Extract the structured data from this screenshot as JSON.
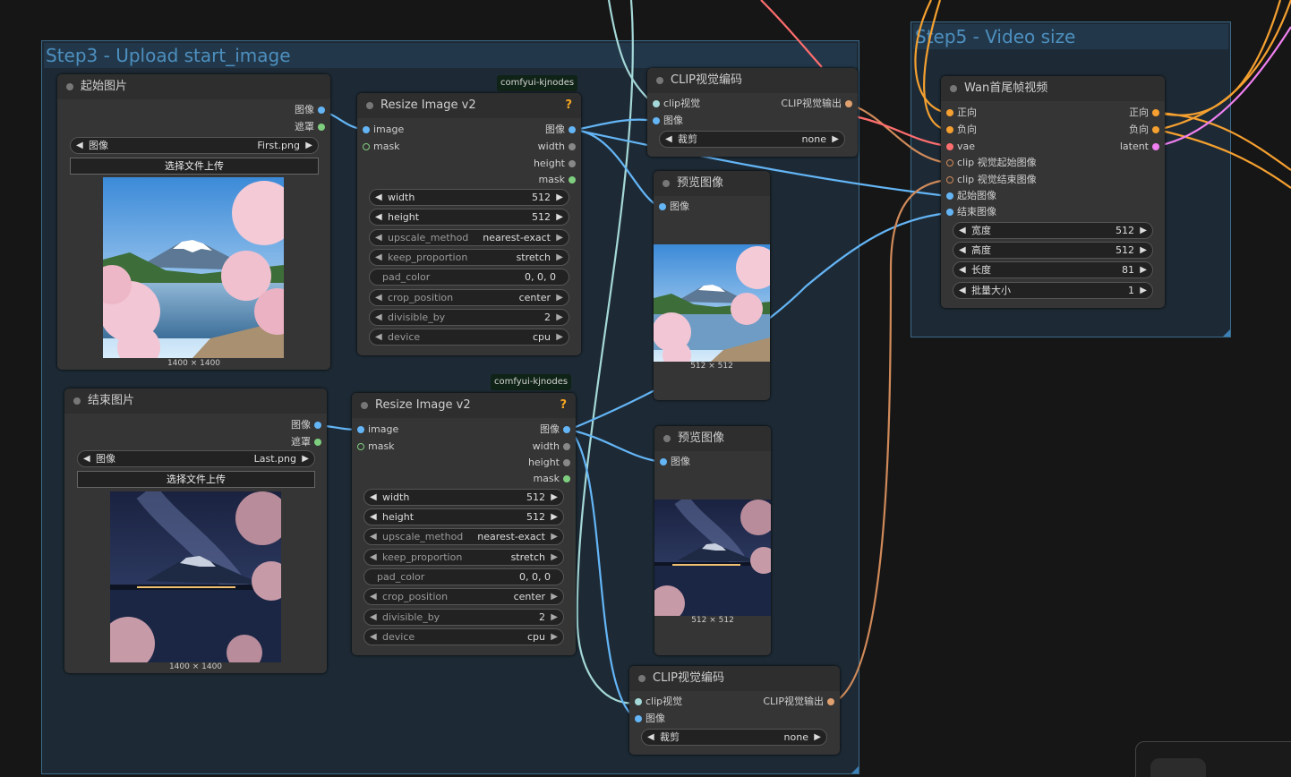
{
  "groups": {
    "step3": {
      "title": "Step3 - Upload start_image"
    },
    "step5": {
      "title": "Step5 - Video size"
    }
  },
  "nodes": {
    "start_image": {
      "title": "起始图片",
      "outputs": [
        "图像",
        "遮罩"
      ],
      "image_widget": {
        "label": "图像",
        "value": "First.png"
      },
      "upload_label": "选择文件上传",
      "size": "1400 × 1400"
    },
    "end_image": {
      "title": "结束图片",
      "outputs": [
        "图像",
        "遮罩"
      ],
      "image_widget": {
        "label": "图像",
        "value": "Last.png"
      },
      "upload_label": "选择文件上传",
      "size": "1400 × 1400"
    },
    "resize1": {
      "badge": "comfyui-kjnodes",
      "title": "Resize Image v2",
      "help": "?",
      "inputs": [
        "image",
        "mask"
      ],
      "outputs": [
        "图像",
        "width",
        "height",
        "mask"
      ],
      "widgets": [
        {
          "label": "width",
          "value": "512"
        },
        {
          "label": "height",
          "value": "512"
        },
        {
          "label": "upscale_method",
          "value": "nearest-exact"
        },
        {
          "label": "keep_proportion",
          "value": "stretch"
        },
        {
          "label": "pad_color",
          "value": "0, 0, 0"
        },
        {
          "label": "crop_position",
          "value": "center"
        },
        {
          "label": "divisible_by",
          "value": "2"
        },
        {
          "label": "device",
          "value": "cpu"
        }
      ]
    },
    "resize2": {
      "badge": "comfyui-kjnodes",
      "title": "Resize Image v2",
      "help": "?",
      "inputs": [
        "image",
        "mask"
      ],
      "outputs": [
        "图像",
        "width",
        "height",
        "mask"
      ],
      "widgets": [
        {
          "label": "width",
          "value": "512"
        },
        {
          "label": "height",
          "value": "512"
        },
        {
          "label": "upscale_method",
          "value": "nearest-exact"
        },
        {
          "label": "keep_proportion",
          "value": "stretch"
        },
        {
          "label": "pad_color",
          "value": "0, 0, 0"
        },
        {
          "label": "crop_position",
          "value": "center"
        },
        {
          "label": "divisible_by",
          "value": "2"
        },
        {
          "label": "device",
          "value": "cpu"
        }
      ]
    },
    "clip1": {
      "title": "CLIP视觉编码",
      "inputs": [
        "clip视觉",
        "图像"
      ],
      "output": "CLIP视觉输出",
      "widget": {
        "label": "裁剪",
        "value": "none"
      }
    },
    "clip2": {
      "title": "CLIP视觉编码",
      "inputs": [
        "clip视觉",
        "图像"
      ],
      "output": "CLIP视觉输出",
      "widget": {
        "label": "裁剪",
        "value": "none"
      }
    },
    "preview1": {
      "title": "预览图像",
      "input": "图像",
      "size": "512 × 512"
    },
    "preview2": {
      "title": "预览图像",
      "input": "图像",
      "size": "512 × 512"
    },
    "wan": {
      "title": "Wan首尾帧视频",
      "inputs": [
        "正向",
        "负向",
        "vae",
        "clip 视觉起始图像",
        "clip 视觉结束图像",
        "起始图像",
        "结束图像"
      ],
      "outputs": [
        "正向",
        "负向",
        "latent"
      ],
      "widgets": [
        {
          "label": "宽度",
          "value": "512"
        },
        {
          "label": "高度",
          "value": "512"
        },
        {
          "label": "长度",
          "value": "81"
        },
        {
          "label": "批量大小",
          "value": "1"
        }
      ]
    }
  },
  "colors": {
    "image_wire": "#64b5f6",
    "clip_vision_wire": "#a5d8d8",
    "clip_vision_output_wire": "#d08a5a",
    "conditioning_wire": "#f5a030",
    "vae_wire": "#ff6e6e",
    "latent_wire": "#f080f0",
    "group_border": "#3a6a8a",
    "group_title": "#4d8fbf"
  }
}
